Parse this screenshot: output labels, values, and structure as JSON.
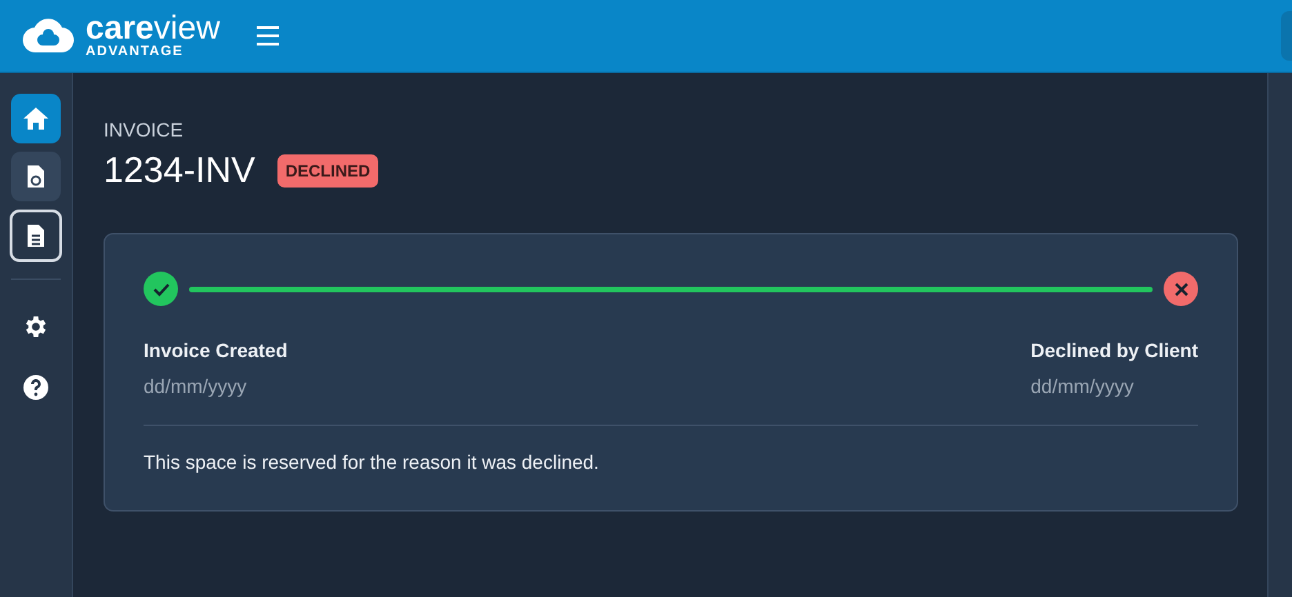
{
  "header": {
    "logo": {
      "name": "**care**view",
      "tagline": "ADVANTAGE"
    }
  },
  "sidebar": {
    "items": [
      {
        "selected": true,
        "highlighted": false,
        "focused": false
      },
      {
        "selected": false,
        "highlighted": true,
        "focused": false
      },
      {
        "selected": false,
        "highlighted": false,
        "focused": true
      }
    ]
  },
  "page": {
    "eyebrow": "INVOICE",
    "title": "1234-INV",
    "status": "DECLINED"
  },
  "timeline": {
    "steps": [
      {
        "kind": "done",
        "label": "Invoice Created",
        "date": "dd/mm/yyyy"
      },
      {
        "kind": "declined",
        "label": "Declined by Client",
        "date": "dd/mm/yyyy"
      }
    ],
    "note": "This space is reserved for the reason it was declined."
  }
}
